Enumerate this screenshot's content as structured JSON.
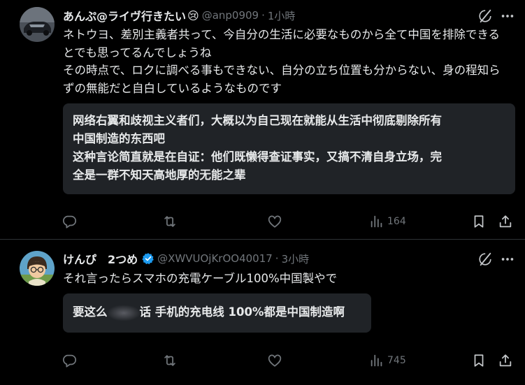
{
  "posts": [
    {
      "author_name": "あんぷ@ライヴ行きたい",
      "name_emoji": "😢",
      "handle": "@anp0909",
      "separator": "·",
      "time": "1小時",
      "text": "ネトウヨ、差別主義者共って、今自分の生活に必要なものから全て中国を排除できるとでも思ってるんでしょうね\nその時点で、ロクに調べる事もできない、自分の立ち位置も分からない、身の程知らずの無能だと自白しているようなものです",
      "translation_lines": [
        "网络右翼和歧视主义者们，大概以为自己现在就能从生活中彻底剔除所有",
        "中国制造的东西吧",
        "这种言论简直就是在自证：他们既懒得查证事实，又搞不清自身立场，完",
        "全是一群不知天高地厚的无能之辈"
      ],
      "views": "164"
    },
    {
      "author_name": "けんぴ　2つめ",
      "handle": "@XWVUOjKrOO40017",
      "separator": "·",
      "time": "3小時",
      "text": "それ言ったらスマホの充電ケーブル100%中国製やで",
      "translation_before": "要这么",
      "translation_after": "话 手机的充电线 100%都是中国制造啊",
      "views": "745"
    }
  ],
  "icons": {
    "grok": "grok-icon",
    "more": "more-icon",
    "reply": "reply-icon",
    "retweet": "retweet-icon",
    "like": "heart-icon",
    "views": "views-icon",
    "bookmark": "bookmark-icon",
    "share": "share-icon",
    "verified": "verified-badge-icon"
  },
  "colors": {
    "background": "#000000",
    "text": "#e7e9ea",
    "muted": "#71767b",
    "translation_bg": "#202327",
    "verified": "#1d9bf0"
  }
}
